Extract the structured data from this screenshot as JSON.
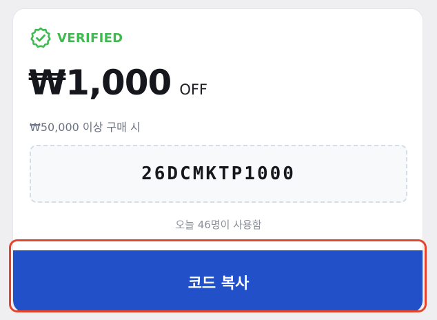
{
  "coupon": {
    "verified_label": "VERIFIED",
    "discount_amount": "₩1,000",
    "discount_suffix": "OFF",
    "condition": "₩50,000 이상 구매 시",
    "code": "26DCMKTP1000",
    "usage": "오늘 46명이 사용함",
    "copy_button_label": "코드 복사"
  },
  "colors": {
    "verified_green": "#3fb950",
    "button_blue": "#2150c8",
    "highlight_red": "#e2452b"
  },
  "icons": {
    "verified": "verified-badge-icon"
  }
}
